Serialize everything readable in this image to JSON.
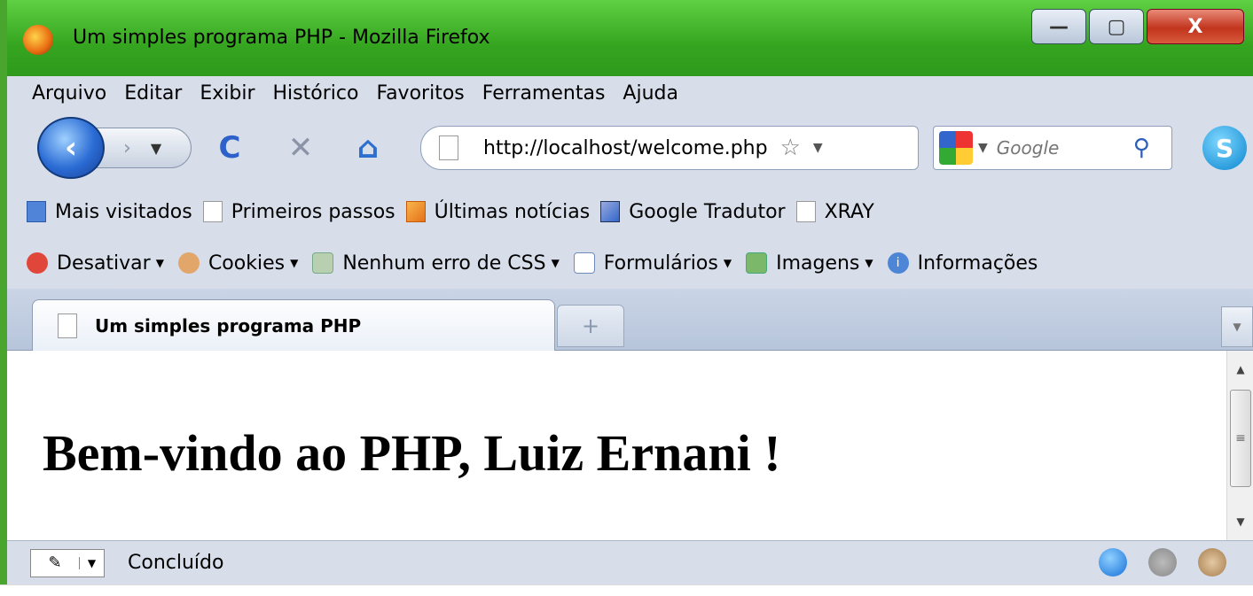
{
  "window": {
    "title": "Um simples programa PHP - Mozilla Firefox",
    "controls": {
      "minimize": "—",
      "maximize": "▢",
      "close": "X"
    }
  },
  "menubar": {
    "items": [
      "Arquivo",
      "Editar",
      "Exibir",
      "Histórico",
      "Favoritos",
      "Ferramentas",
      "Ajuda"
    ]
  },
  "navbar": {
    "url": "http://localhost/welcome.php",
    "search_placeholder": "Google",
    "icons": {
      "back": "‹",
      "forward": "›",
      "reload": "C",
      "stop": "✕",
      "home": "⌂",
      "star": "☆",
      "search": "⚲",
      "skype": "S"
    }
  },
  "bookmarks": {
    "items": [
      "Mais visitados",
      "Primeiros passos",
      "Últimas notícias",
      "Google Tradutor",
      "XRAY"
    ]
  },
  "webdev": {
    "items": [
      "Desativar",
      "Cookies",
      "Nenhum erro de CSS",
      "Formulários",
      "Imagens",
      "Informações"
    ]
  },
  "tabs": {
    "active_label": "Um simples programa PHP",
    "new_tab": "+"
  },
  "content": {
    "heading": "Bem-vindo ao PHP, Luiz Ernani !"
  },
  "statusbar": {
    "text": "Concluído"
  }
}
